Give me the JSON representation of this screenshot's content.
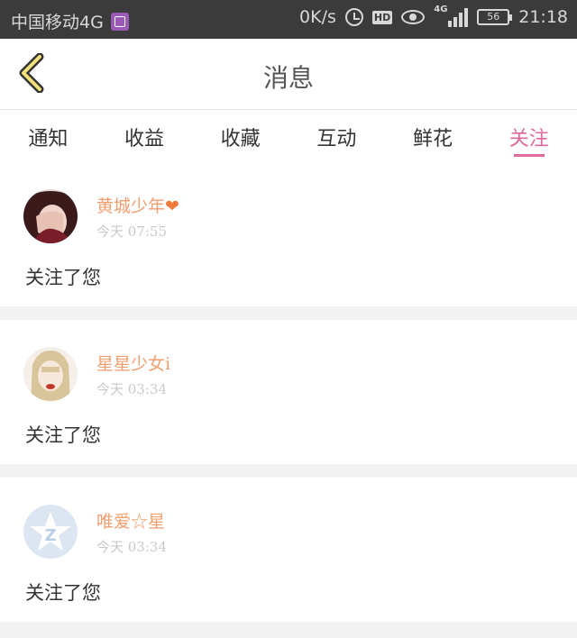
{
  "status_bar": {
    "carrier": "中国移动4G",
    "speed": "0K/s",
    "hd": "HD",
    "network": "4G",
    "battery": "56",
    "time": "21:18"
  },
  "header": {
    "title": "消息",
    "back_icon": "chevron-left-icon"
  },
  "tabs": [
    {
      "label": "通知",
      "active": false
    },
    {
      "label": "收益",
      "active": false
    },
    {
      "label": "收藏",
      "active": false
    },
    {
      "label": "互动",
      "active": false
    },
    {
      "label": "鲜花",
      "active": false
    },
    {
      "label": "关注",
      "active": true
    }
  ],
  "items": [
    {
      "name": "黄城少年",
      "time": "今天 07:55",
      "content": "关注了您",
      "heart": "❤"
    },
    {
      "name": "星星少女i",
      "time": "今天 03:34",
      "content": "关注了您"
    },
    {
      "name": "唯爱☆星",
      "time": "今天 03:34",
      "content": "关注了您"
    }
  ],
  "colors": {
    "accent": "#e06a9c",
    "name": "#f29e6f",
    "statusbar": "#3b3b3b"
  }
}
